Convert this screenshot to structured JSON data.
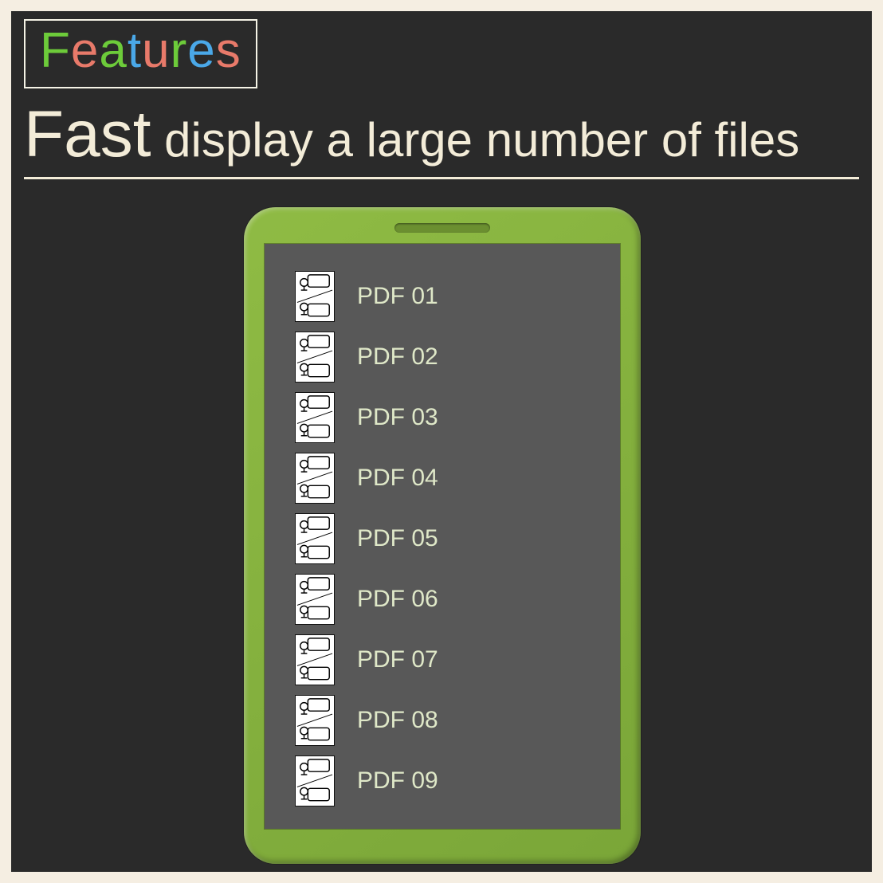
{
  "badge": {
    "letters": [
      "F",
      "e",
      "a",
      "t",
      "u",
      "r",
      "e",
      "s"
    ]
  },
  "headline": {
    "big": "Fast",
    "rest": " display a large number of files"
  },
  "files": [
    {
      "label": "PDF 01"
    },
    {
      "label": "PDF 02"
    },
    {
      "label": "PDF 03"
    },
    {
      "label": "PDF 04"
    },
    {
      "label": "PDF 05"
    },
    {
      "label": "PDF 06"
    },
    {
      "label": "PDF 07"
    },
    {
      "label": "PDF 08"
    },
    {
      "label": "PDF 09"
    }
  ]
}
